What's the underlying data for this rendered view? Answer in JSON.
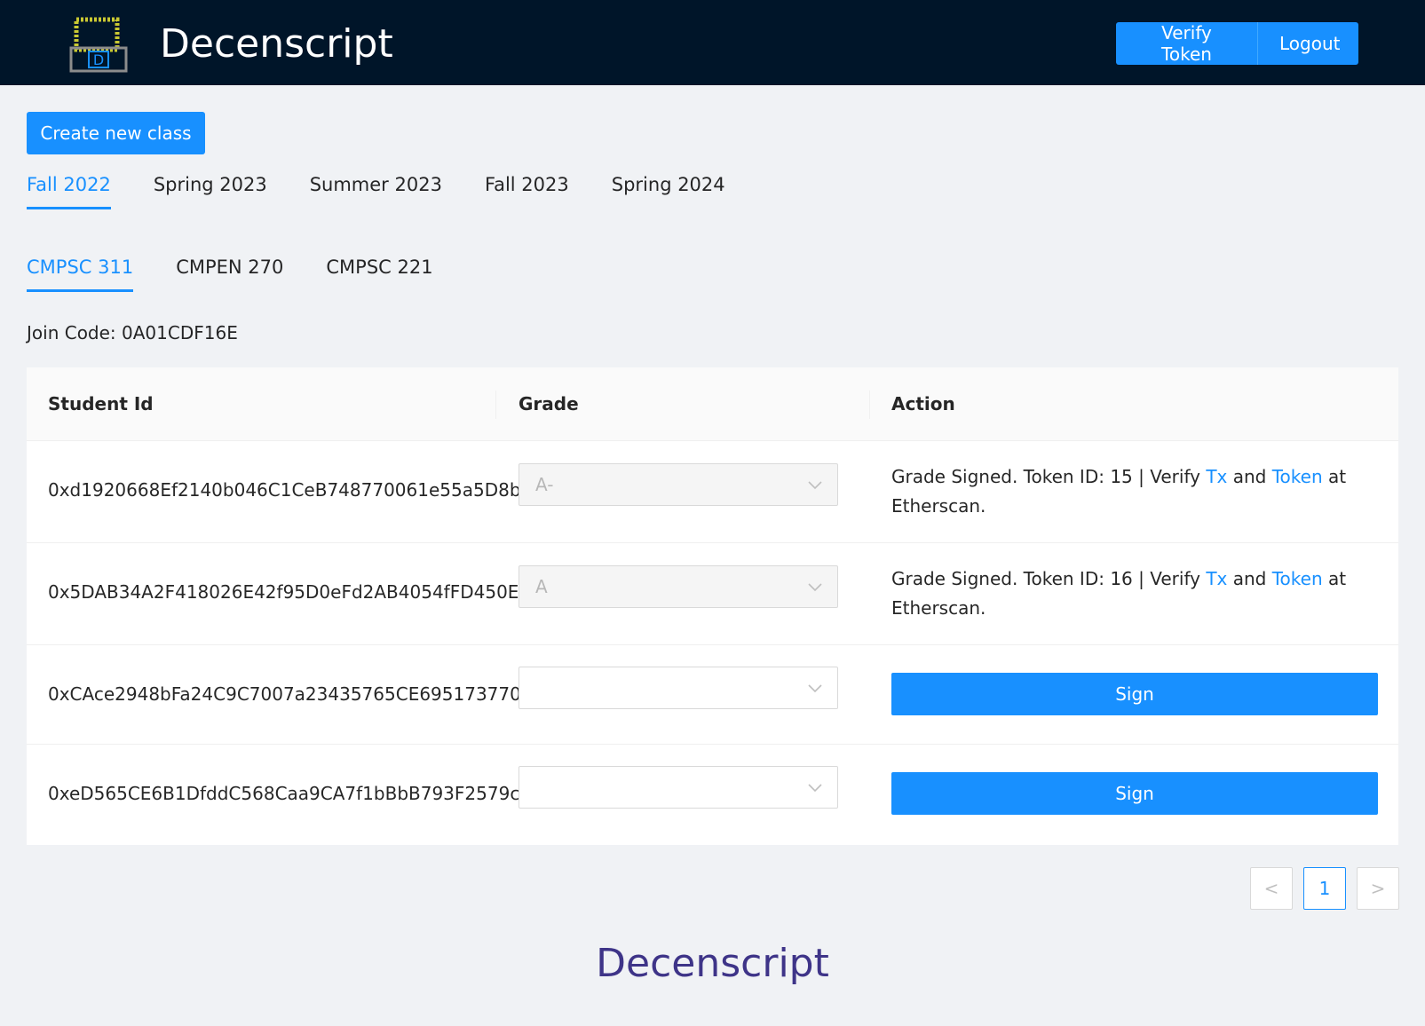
{
  "header": {
    "title": "Decenscript",
    "verify_label": "Verify Token",
    "logout_label": "Logout"
  },
  "create_class_label": "Create new class",
  "semesters": [
    {
      "label": "Fall 2022",
      "active": true
    },
    {
      "label": "Spring 2023",
      "active": false
    },
    {
      "label": "Summer 2023",
      "active": false
    },
    {
      "label": "Fall 2023",
      "active": false
    },
    {
      "label": "Spring 2024",
      "active": false
    }
  ],
  "classes": [
    {
      "label": "CMPSC 311",
      "active": true
    },
    {
      "label": "CMPEN 270",
      "active": false
    },
    {
      "label": "CMPSC 221",
      "active": false
    }
  ],
  "join_code": "Join Code: 0A01CDF16E",
  "table": {
    "columns": [
      "Student Id",
      "Grade",
      "Action"
    ],
    "rows": [
      {
        "student_id": "0xd1920668Ef2140b046C1CeB748770061e55a5D8b",
        "grade": "A-",
        "action_prefix": "Grade Signed. Token ID: 15 | Verify ",
        "tx_label": "Tx",
        "and_label": " and ",
        "token_label": "Token",
        "action_suffix": " at Etherscan."
      },
      {
        "student_id": "0x5DAB34A2F418026E42f95D0eFd2AB4054fFD450E",
        "grade": "A",
        "action_prefix": "Grade Signed. Token ID: 16 | Verify ",
        "tx_label": "Tx",
        "and_label": " and ",
        "token_label": "Token",
        "action_suffix": " at Etherscan."
      },
      {
        "student_id": "0xCAce2948bFa24C9C7007a23435765CE695173770",
        "grade": "",
        "sign_label": "Sign"
      },
      {
        "student_id": "0xeD565CE6B1DfddC568Caa9CA7f1bBbB793F2579c",
        "grade": "",
        "sign_label": "Sign"
      }
    ]
  },
  "pagination": {
    "prev": "<",
    "current": "1",
    "next": ">"
  },
  "footer": {
    "title": "Decenscript"
  },
  "colors": {
    "header_bg": "#001529",
    "accent": "#1890ff",
    "footer_title": "#3e3488"
  },
  "icons": {
    "logo": "graduation-cap-logo",
    "select_arrow": "chevron-down-icon"
  }
}
